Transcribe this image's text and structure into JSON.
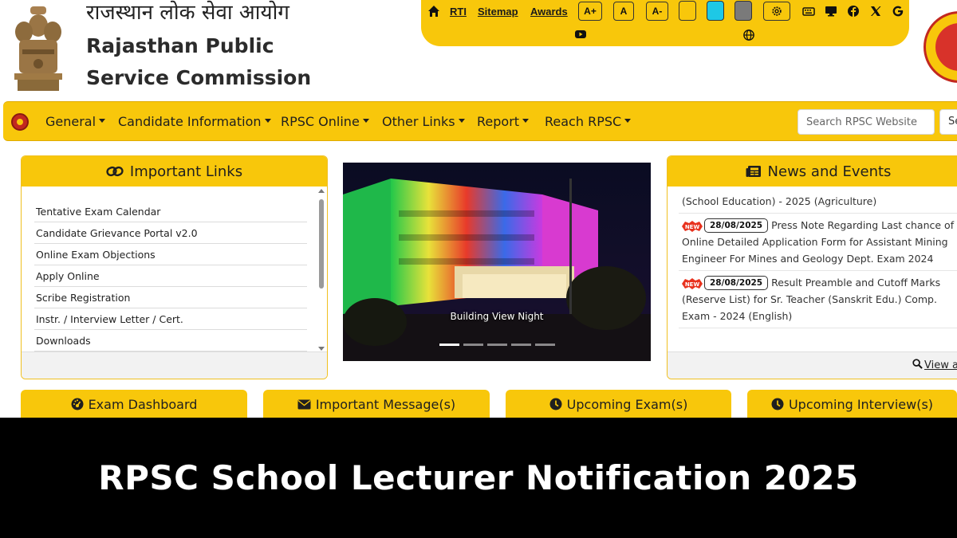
{
  "header": {
    "title_hindi": "राजस्थान लोक सेवा आयोग",
    "title_english": "Rajasthan Public Service Commission"
  },
  "utility": {
    "links": [
      "RTI",
      "Sitemap",
      "Awards"
    ],
    "font_buttons": [
      "A+",
      "A",
      "A-"
    ],
    "theme_colors": [
      "#f8c70b",
      "#1ec8e6",
      "#7a7a7a"
    ],
    "icons": [
      "home-icon",
      "gear-icon",
      "keyboard-icon",
      "desktop-icon",
      "facebook-icon",
      "x-twitter-icon",
      "google-icon",
      "youtube-icon",
      "globe-icon"
    ]
  },
  "nav": {
    "items": [
      "General",
      "Candidate Information",
      "RPSC Online",
      "Other Links",
      "Report",
      "Reach RPSC"
    ],
    "search_placeholder": "Search RPSC Website",
    "search_button": "Search"
  },
  "important_links": {
    "title": "Important Links",
    "items": [
      "Tentative Exam Calendar",
      "Candidate Grievance Portal v2.0",
      "Online Exam Objections",
      "Apply Online",
      "Scribe Registration",
      "Instr. / Interview Letter / Cert.",
      "Downloads"
    ]
  },
  "carousel": {
    "caption": "Building View Night",
    "slide_count": 5,
    "active_index": 0
  },
  "news": {
    "title": "News and Events",
    "partial_item": "(School Education) - 2025 (Agriculture)",
    "items": [
      {
        "date": "28/08/2025",
        "text": "Press Note Regarding Last chance of Online Detailed Application Form for Assistant Mining Engineer For Mines and Geology Dept. Exam 2024"
      },
      {
        "date": "28/08/2025",
        "text": "Result Preamble and Cutoff Marks (Reserve List) for Sr. Teacher (Sanskrit Edu.) Comp. Exam - 2024 (English)"
      }
    ],
    "view_all": "View all"
  },
  "tiles": [
    {
      "label": "Exam Dashboard",
      "icon": "dashboard-icon"
    },
    {
      "label": "Important Message(s)",
      "icon": "envelope-icon"
    },
    {
      "label": "Upcoming Exam(s)",
      "icon": "clock-icon"
    },
    {
      "label": "Upcoming Interview(s)",
      "icon": "clock-icon"
    }
  ],
  "banner": {
    "text": "RPSC School Lecturer Notification 2025"
  },
  "colors": {
    "accent": "#f8c70b",
    "banner_bg": "#000000"
  }
}
